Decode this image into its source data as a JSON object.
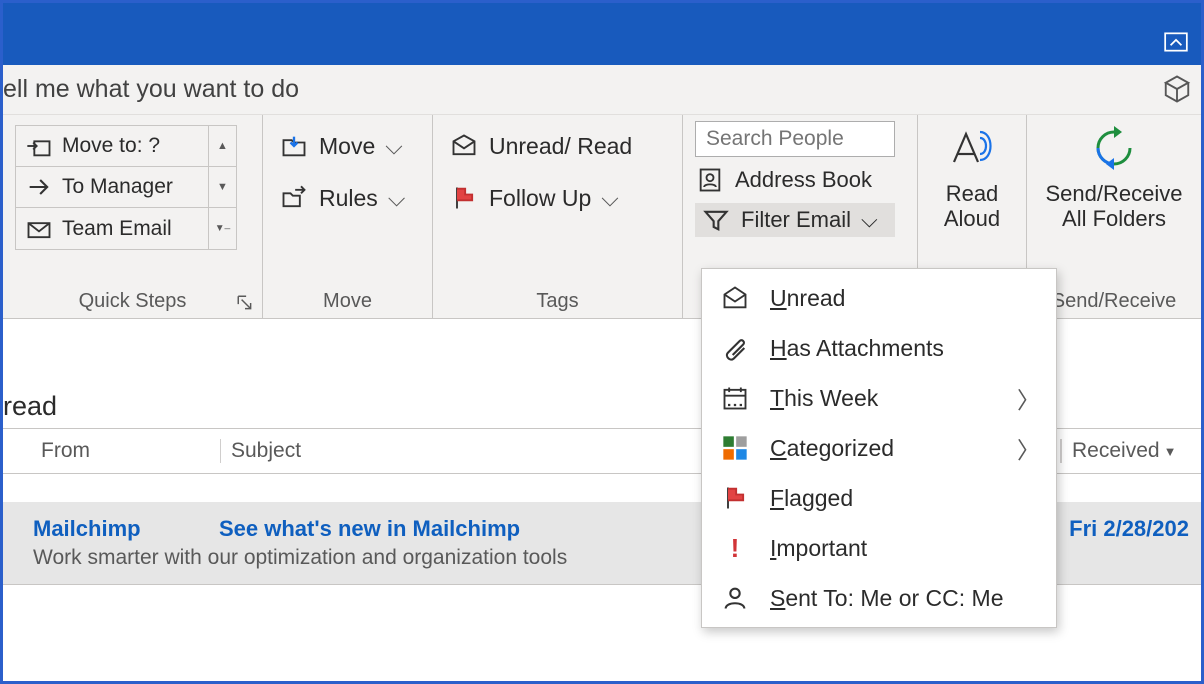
{
  "tell_me": "ell me what you want to do",
  "groups": {
    "quick_steps": {
      "caption": "Quick Steps",
      "items": [
        "Move to: ?",
        "To Manager",
        "Team Email"
      ]
    },
    "move": {
      "caption": "Move",
      "move_btn": "Move",
      "rules_btn": "Rules"
    },
    "tags": {
      "caption": "Tags",
      "unread": "Unread/ Read",
      "follow": "Follow Up"
    },
    "find": {
      "search_placeholder": "Search People",
      "address_book": "Address Book",
      "filter_email": "Filter Email"
    },
    "read_aloud": {
      "line1": "Read",
      "line2": "Aloud"
    },
    "send_receive": {
      "line1": "Send/Receive",
      "line2": "All Folders",
      "caption": "Send/Receive"
    }
  },
  "filter_menu": {
    "unread": "Unread",
    "has_att": "Has Attachments",
    "this_week": "This Week",
    "categorized": "Categorized",
    "flagged": "Flagged",
    "important": "Important",
    "sent_to": "Sent To: Me or CC: Me"
  },
  "view_label": "read",
  "columns": {
    "from": "From",
    "subject": "Subject",
    "received": "Received"
  },
  "messages": [
    {
      "from": "Mailchimp",
      "subject": "See what's new in Mailchimp",
      "preview": "Work smarter with our optimization and organization tools",
      "date": "Fri 2/28/202"
    }
  ]
}
